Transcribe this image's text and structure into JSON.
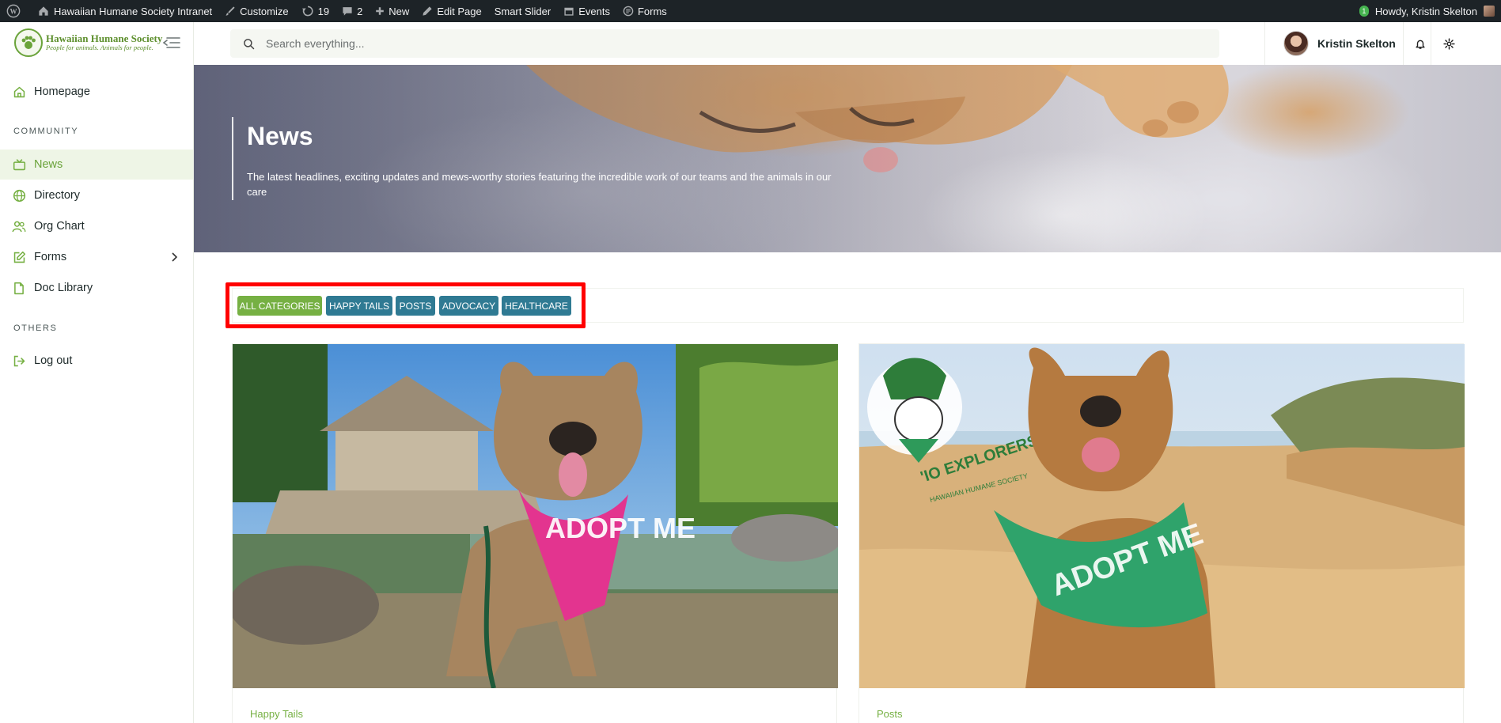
{
  "adminbar": {
    "site_name": "Hawaiian Humane Society Intranet",
    "customize": "Customize",
    "updates_count": "19",
    "comments_count": "2",
    "new": "New",
    "edit_page": "Edit Page",
    "smart_slider": "Smart Slider",
    "events": "Events",
    "forms": "Forms",
    "notification_count": "1",
    "howdy": "Howdy, Kristin Skelton"
  },
  "logo": {
    "title": "Hawaiian Humane Society",
    "tagline": "People for animals. Animals for people."
  },
  "sidebar": {
    "homepage": "Homepage",
    "section_community": "COMMUNITY",
    "news": "News",
    "directory": "Directory",
    "org_chart": "Org Chart",
    "forms": "Forms",
    "doc_library": "Doc Library",
    "section_others": "OTHERS",
    "logout": "Log out"
  },
  "search": {
    "placeholder": "Search everything..."
  },
  "user": {
    "name": "Kristin Skelton"
  },
  "hero": {
    "title": "News",
    "description": "The latest headlines, exciting updates and mews-worthy stories featuring the incredible work of our teams and the animals in our care"
  },
  "categories": {
    "all": "ALL CATEGORIES",
    "happy_tails": "HAPPY TAILS",
    "posts": "POSTS",
    "advocacy": "ADVOCACY",
    "healthcare": "HEALTHCARE"
  },
  "cards": [
    {
      "category": "Happy Tails",
      "bandana_text": "ADOPT ME"
    },
    {
      "category": "Posts",
      "bandana_text": "ADOPT ME",
      "logo_text": "'IO EXPLORERS",
      "logo_subtext": "HAWAIIAN HUMANE SOCIETY"
    }
  ],
  "colors": {
    "brand_green": "#76b043",
    "category_blue": "#2f7a93",
    "admin_bar": "#1d2327",
    "highlight_red": "#ff0000"
  }
}
